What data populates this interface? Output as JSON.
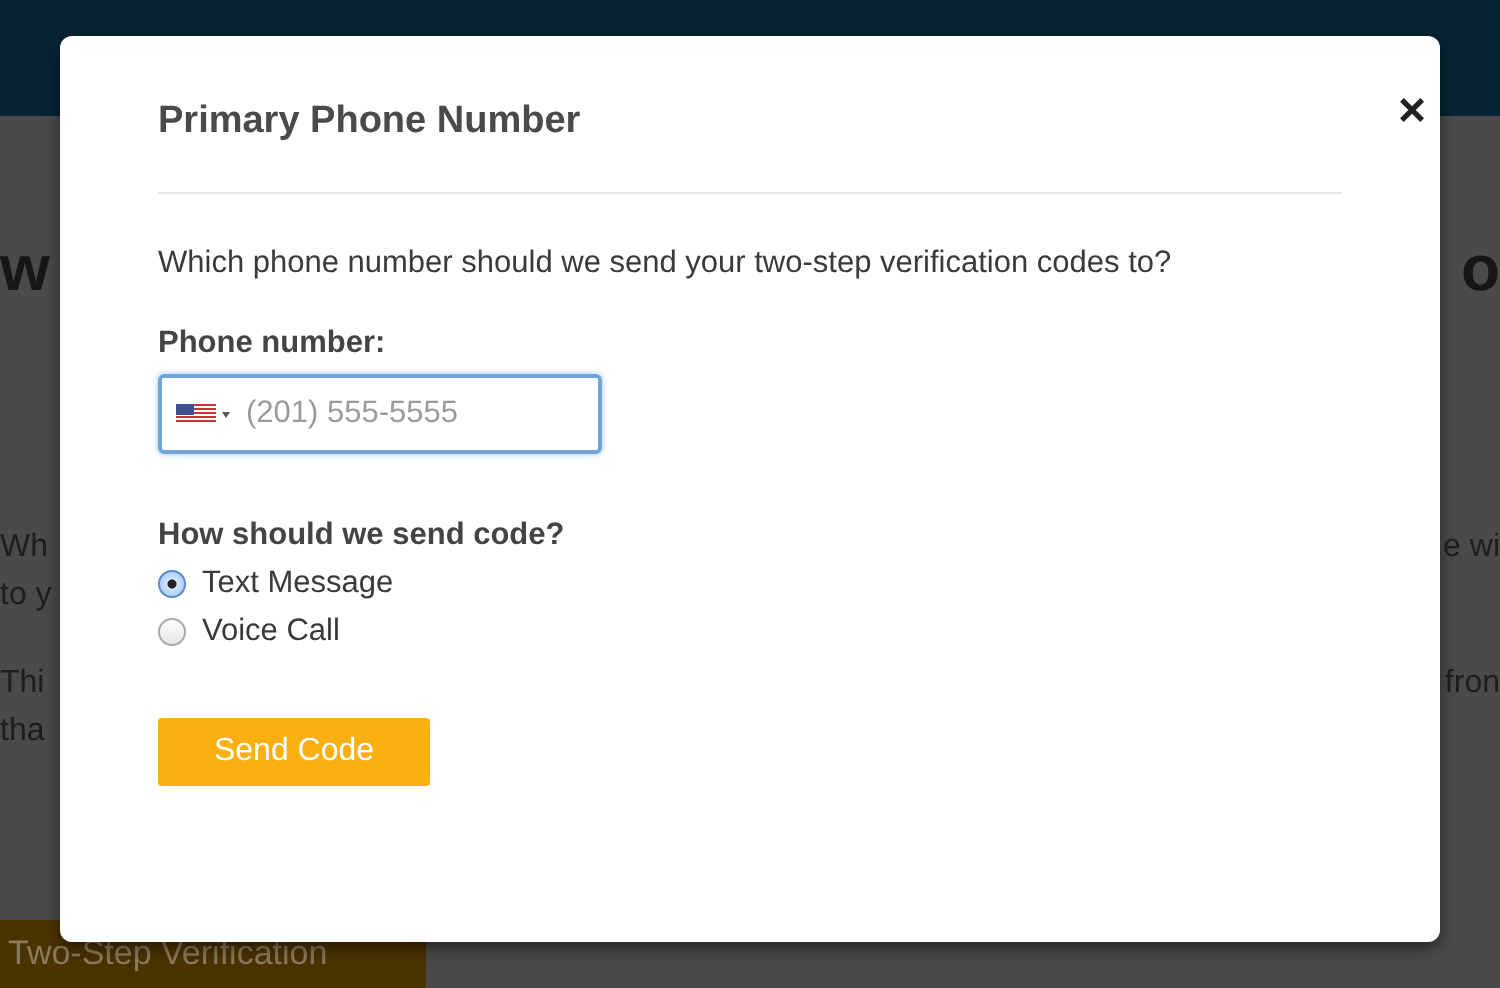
{
  "background": {
    "heading_left": "w",
    "heading_right": "o",
    "left_lines": [
      "Wh",
      "to y",
      "Thi",
      "tha"
    ],
    "right_lines": [
      "e wi",
      "fron"
    ],
    "button": "Two-Step Verification"
  },
  "dialog": {
    "title": "Primary Phone Number",
    "close": "×",
    "question": "Which phone number should we send your two-step verification codes to?",
    "phone_label": "Phone number:",
    "phone_placeholder": "(201) 555-5555",
    "method_label": "How should we send code?",
    "methods": [
      {
        "label": "Text Message",
        "selected": true
      },
      {
        "label": "Voice Call",
        "selected": false
      }
    ],
    "submit": "Send Code"
  }
}
